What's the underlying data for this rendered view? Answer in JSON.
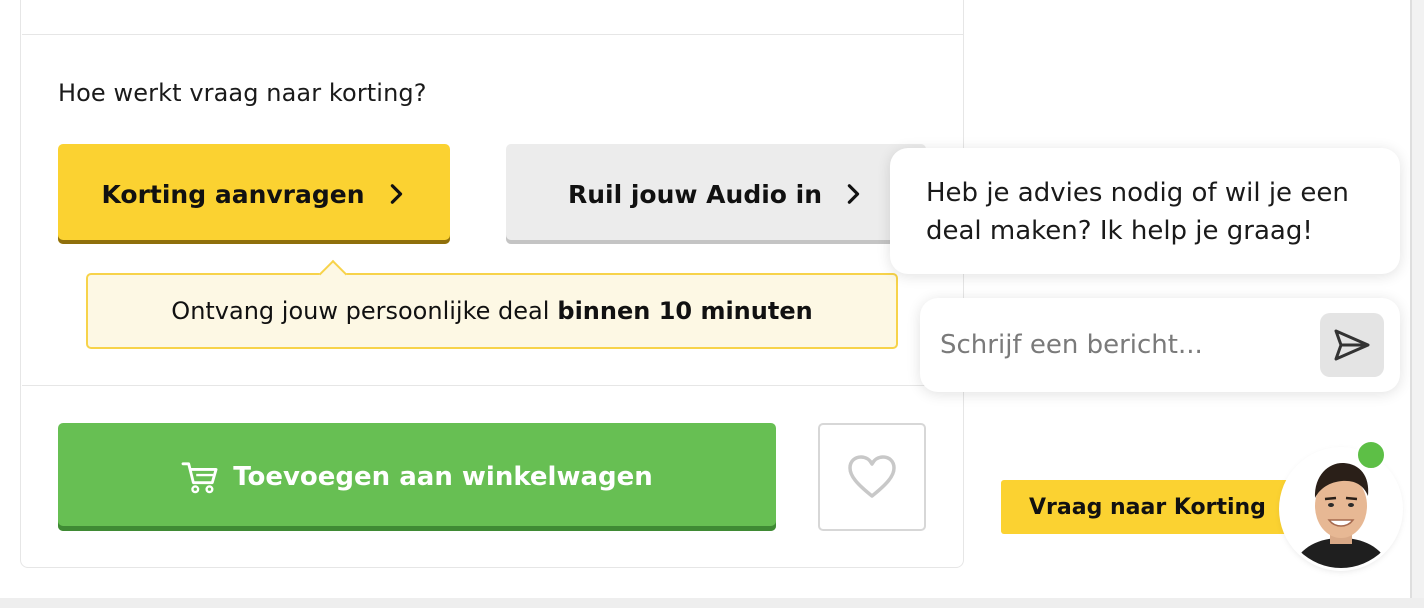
{
  "product": {
    "question": "Hoe werkt vraag naar korting?",
    "korting_button": "Korting aanvragen",
    "ruil_button": "Ruil jouw Audio in",
    "deal_text": "Ontvang jouw persoonlijke deal",
    "deal_emphasis": "binnen 10 minuten",
    "cart_button": "Toevoegen aan winkelwagen"
  },
  "chat": {
    "message": "Heb je advies nodig of wil je een deal maken? Ik help je graag!",
    "input_placeholder": "Schrijf een bericht...",
    "launcher_label": "Vraag naar Korting",
    "online_status_color": "#5dbf46"
  },
  "colors": {
    "accent_yellow": "#fbd231",
    "cart_green": "#67bf53",
    "secondary_gray": "#ececec"
  },
  "icons": {
    "chevron": "chevron-right-icon",
    "cart": "shopping-cart-icon",
    "favorite": "heart-icon",
    "send": "send-icon"
  }
}
